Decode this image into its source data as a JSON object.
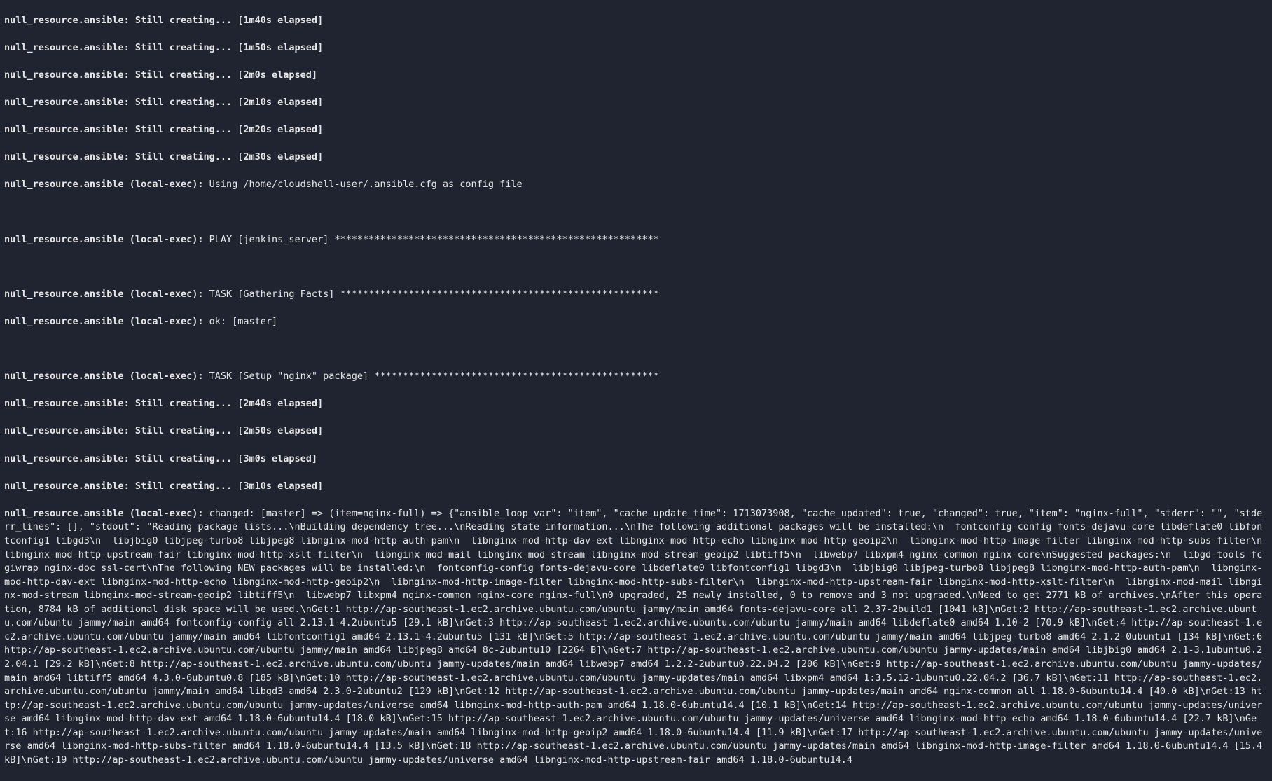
{
  "lines": {
    "l0": "null_resource.ansible: Still creating... [1m40s elapsed]",
    "l1": "null_resource.ansible: Still creating... [1m50s elapsed]",
    "l2": "null_resource.ansible: Still creating... [2m0s elapsed]",
    "l3": "null_resource.ansible: Still creating... [2m10s elapsed]",
    "l4": "null_resource.ansible: Still creating... [2m20s elapsed]",
    "l5": "null_resource.ansible: Still creating... [2m30s elapsed]",
    "l6a": "null_resource.ansible (local-exec):",
    "l6b": " Using /home/cloudshell-user/.ansible.cfg as config file",
    "l7a": "null_resource.ansible (local-exec):",
    "l7b": " PLAY [jenkins_server] *********************************************************",
    "l8a": "null_resource.ansible (local-exec):",
    "l8b": " TASK [Gathering Facts] ********************************************************",
    "l9a": "null_resource.ansible (local-exec):",
    "l9b": " ok: [master]",
    "l10a": "null_resource.ansible (local-exec):",
    "l10b": " TASK [Setup \"nginx\" package] **************************************************",
    "l11": "null_resource.ansible: Still creating... [2m40s elapsed]",
    "l12": "null_resource.ansible: Still creating... [2m50s elapsed]",
    "l13": "null_resource.ansible: Still creating... [3m0s elapsed]",
    "l14": "null_resource.ansible: Still creating... [3m10s elapsed]",
    "l15a": "null_resource.ansible (local-exec):",
    "l15b": " changed: [master] => (item=nginx-full) => {\"ansible_loop_var\": \"item\", \"cache_update_time\": 1713073908, \"cache_updated\": true, \"changed\": true, \"item\": \"nginx-full\", \"stderr\": \"\", \"stderr_lines\": [], \"stdout\": \"Reading package lists...\\nBuilding dependency tree...\\nReading state information...\\nThe following additional packages will be installed:\\n  fontconfig-config fonts-dejavu-core libdeflate0 libfontconfig1 libgd3\\n  libjbig0 libjpeg-turbo8 libjpeg8 libnginx-mod-http-auth-pam\\n  libnginx-mod-http-dav-ext libnginx-mod-http-echo libnginx-mod-http-geoip2\\n  libnginx-mod-http-image-filter libnginx-mod-http-subs-filter\\n  libnginx-mod-http-upstream-fair libnginx-mod-http-xslt-filter\\n  libnginx-mod-mail libnginx-mod-stream libnginx-mod-stream-geoip2 libtiff5\\n  libwebp7 libxpm4 nginx-common nginx-core\\nSuggested packages:\\n  libgd-tools fcgiwrap nginx-doc ssl-cert\\nThe following NEW packages will be installed:\\n  fontconfig-config fonts-dejavu-core libdeflate0 libfontconfig1 libgd3\\n  libjbig0 libjpeg-turbo8 libjpeg8 libnginx-mod-http-auth-pam\\n  libnginx-mod-http-dav-ext libnginx-mod-http-echo libnginx-mod-http-geoip2\\n  libnginx-mod-http-image-filter libnginx-mod-http-subs-filter\\n  libnginx-mod-http-upstream-fair libnginx-mod-http-xslt-filter\\n  libnginx-mod-mail libnginx-mod-stream libnginx-mod-stream-geoip2 libtiff5\\n  libwebp7 libxpm4 nginx-common nginx-core nginx-full\\n0 upgraded, 25 newly installed, 0 to remove and 3 not upgraded.\\nNeed to get 2771 kB of archives.\\nAfter this operation, 8784 kB of additional disk space will be used.\\nGet:1 http://ap-southeast-1.ec2.archive.ubuntu.com/ubuntu jammy/main amd64 fonts-dejavu-core all 2.37-2build1 [1041 kB]\\nGet:2 http://ap-southeast-1.ec2.archive.ubuntu.com/ubuntu jammy/main amd64 fontconfig-config all 2.13.1-4.2ubuntu5 [29.1 kB]\\nGet:3 http://ap-southeast-1.ec2.archive.ubuntu.com/ubuntu jammy/main amd64 libdeflate0 amd64 1.10-2 [70.9 kB]\\nGet:4 http://ap-southeast-1.ec2.archive.ubuntu.com/ubuntu jammy/main amd64 libfontconfig1 amd64 2.13.1-4.2ubuntu5 [131 kB]\\nGet:5 http://ap-southeast-1.ec2.archive.ubuntu.com/ubuntu jammy/main amd64 libjpeg-turbo8 amd64 2.1.2-0ubuntu1 [134 kB]\\nGet:6 http://ap-southeast-1.ec2.archive.ubuntu.com/ubuntu jammy/main amd64 libjpeg8 amd64 8c-2ubuntu10 [2264 B]\\nGet:7 http://ap-southeast-1.ec2.archive.ubuntu.com/ubuntu jammy-updates/main amd64 libjbig0 amd64 2.1-3.1ubuntu0.22.04.1 [29.2 kB]\\nGet:8 http://ap-southeast-1.ec2.archive.ubuntu.com/ubuntu jammy-updates/main amd64 libwebp7 amd64 1.2.2-2ubuntu0.22.04.2 [206 kB]\\nGet:9 http://ap-southeast-1.ec2.archive.ubuntu.com/ubuntu jammy-updates/main amd64 libtiff5 amd64 4.3.0-6ubuntu0.8 [185 kB]\\nGet:10 http://ap-southeast-1.ec2.archive.ubuntu.com/ubuntu jammy-updates/main amd64 libxpm4 amd64 1:3.5.12-1ubuntu0.22.04.2 [36.7 kB]\\nGet:11 http://ap-southeast-1.ec2.archive.ubuntu.com/ubuntu jammy/main amd64 libgd3 amd64 2.3.0-2ubuntu2 [129 kB]\\nGet:12 http://ap-southeast-1.ec2.archive.ubuntu.com/ubuntu jammy-updates/main amd64 nginx-common all 1.18.0-6ubuntu14.4 [40.0 kB]\\nGet:13 http://ap-southeast-1.ec2.archive.ubuntu.com/ubuntu jammy-updates/universe amd64 libnginx-mod-http-auth-pam amd64 1.18.0-6ubuntu14.4 [10.1 kB]\\nGet:14 http://ap-southeast-1.ec2.archive.ubuntu.com/ubuntu jammy-updates/universe amd64 libnginx-mod-http-dav-ext amd64 1.18.0-6ubuntu14.4 [18.0 kB]\\nGet:15 http://ap-southeast-1.ec2.archive.ubuntu.com/ubuntu jammy-updates/universe amd64 libnginx-mod-http-echo amd64 1.18.0-6ubuntu14.4 [22.7 kB]\\nGet:16 http://ap-southeast-1.ec2.archive.ubuntu.com/ubuntu jammy-updates/main amd64 libnginx-mod-http-geoip2 amd64 1.18.0-6ubuntu14.4 [11.9 kB]\\nGet:17 http://ap-southeast-1.ec2.archive.ubuntu.com/ubuntu jammy-updates/universe amd64 libnginx-mod-http-subs-filter amd64 1.18.0-6ubuntu14.4 [13.5 kB]\\nGet:18 http://ap-southeast-1.ec2.archive.ubuntu.com/ubuntu jammy-updates/main amd64 libnginx-mod-http-image-filter amd64 1.18.0-6ubuntu14.4 [15.4 kB]\\nGet:19 http://ap-southeast-1.ec2.archive.ubuntu.com/ubuntu jammy-updates/universe amd64 libnginx-mod-http-upstream-fair amd64 1.18.0-6ubuntu14.4"
  }
}
